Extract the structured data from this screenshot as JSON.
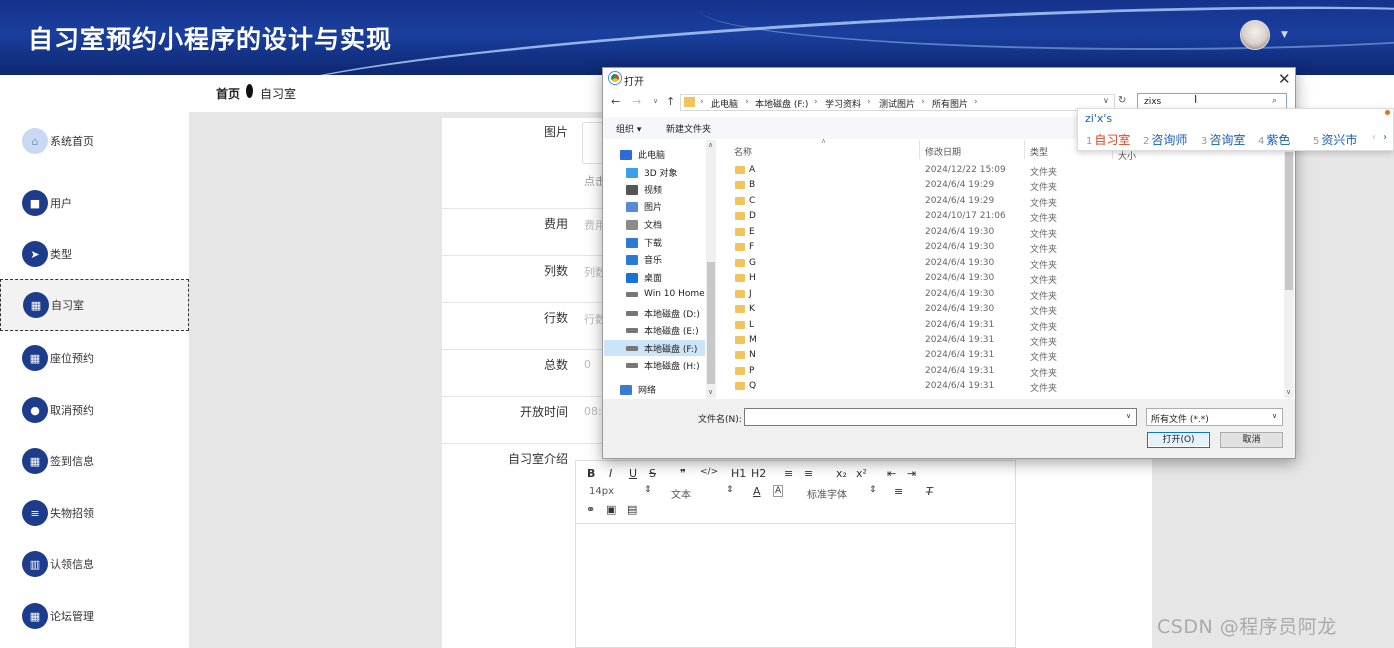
{
  "header": {
    "title": "自习室预约小程序的设计与实现"
  },
  "breadcrumb": {
    "home": "首页",
    "current": "自习室"
  },
  "sidebar": {
    "items": [
      {
        "label": "系统首页",
        "icon": "home-icon",
        "glyph": "⌂"
      },
      {
        "label": "用户",
        "icon": "briefcase-icon",
        "glyph": "■"
      },
      {
        "label": "类型",
        "icon": "paper-plane-icon",
        "glyph": "➤"
      },
      {
        "label": "自习室",
        "icon": "grid-icon",
        "glyph": "▦"
      },
      {
        "label": "座位预约",
        "icon": "grid-icon",
        "glyph": "▦"
      },
      {
        "label": "取消预约",
        "icon": "user-icon",
        "glyph": "●"
      },
      {
        "label": "签到信息",
        "icon": "grid-icon",
        "glyph": "▦"
      },
      {
        "label": "失物招领",
        "icon": "list-icon",
        "glyph": "≡"
      },
      {
        "label": "认领信息",
        "icon": "chart-icon",
        "glyph": "▥"
      },
      {
        "label": "论坛管理",
        "icon": "grid-icon",
        "glyph": "▦"
      }
    ]
  },
  "form": {
    "image_label": "图片",
    "image_hint": "点击",
    "fee_label": "费用",
    "fee_placeholder": "费用",
    "cols_label": "列数",
    "cols_placeholder": "列数",
    "rows_label": "行数",
    "rows_placeholder": "行数",
    "total_label": "总数",
    "total_value": "0",
    "open_time_label": "开放时间",
    "open_time_value": "08:0",
    "intro_label": "自习室介绍"
  },
  "editor": {
    "font_size": "14px",
    "format": "文本",
    "font_family": "标准字体",
    "buttons": [
      "B",
      "I",
      "U",
      "S",
      "❞",
      "</>",
      "H1",
      "H2",
      "≡",
      "≡",
      "x₂",
      "x²",
      "⇤",
      "⇥"
    ]
  },
  "dialog": {
    "title": "打开",
    "path": [
      "此电脑",
      "本地磁盘 (F:)",
      "学习资料",
      "测试图片",
      "所有图片"
    ],
    "search_value": "zixs",
    "organize": "组织 ▾",
    "new_folder": "新建文件夹",
    "columns": {
      "name": "名称",
      "date": "修改日期",
      "type": "类型",
      "size": "大小"
    },
    "nav": [
      {
        "label": "此电脑",
        "icon": "computer-icon",
        "color": "#2b6cd6"
      },
      {
        "label": "3D 对象",
        "icon": "cube-icon",
        "color": "#3aa0e8"
      },
      {
        "label": "视频",
        "icon": "video-icon",
        "color": "#555555"
      },
      {
        "label": "图片",
        "icon": "picture-icon",
        "color": "#5a8ad6"
      },
      {
        "label": "文档",
        "icon": "document-icon",
        "color": "#8a8a8a"
      },
      {
        "label": "下载",
        "icon": "download-icon",
        "color": "#2b7ad6"
      },
      {
        "label": "音乐",
        "icon": "music-icon",
        "color": "#2b7ad6"
      },
      {
        "label": "桌面",
        "icon": "desktop-icon",
        "color": "#1a73d6"
      },
      {
        "label": "Win 10 Home x",
        "icon": "drive-icon",
        "color": "#777777"
      },
      {
        "label": "本地磁盘 (D:)",
        "icon": "drive-icon",
        "color": "#777777"
      },
      {
        "label": "本地磁盘 (E:)",
        "icon": "drive-icon",
        "color": "#777777"
      },
      {
        "label": "本地磁盘 (F:)",
        "icon": "drive-icon",
        "color": "#777777"
      },
      {
        "label": "本地磁盘 (H:)",
        "icon": "drive-icon",
        "color": "#777777"
      },
      {
        "label": "网络",
        "icon": "network-icon",
        "color": "#3a7ad6"
      }
    ],
    "files": [
      {
        "name": "A",
        "date": "2024/12/22 15:09",
        "type": "文件夹"
      },
      {
        "name": "B",
        "date": "2024/6/4 19:29",
        "type": "文件夹"
      },
      {
        "name": "C",
        "date": "2024/6/4 19:29",
        "type": "文件夹"
      },
      {
        "name": "D",
        "date": "2024/10/17 21:06",
        "type": "文件夹"
      },
      {
        "name": "E",
        "date": "2024/6/4 19:30",
        "type": "文件夹"
      },
      {
        "name": "F",
        "date": "2024/6/4 19:30",
        "type": "文件夹"
      },
      {
        "name": "G",
        "date": "2024/6/4 19:30",
        "type": "文件夹"
      },
      {
        "name": "H",
        "date": "2024/6/4 19:30",
        "type": "文件夹"
      },
      {
        "name": "J",
        "date": "2024/6/4 19:30",
        "type": "文件夹"
      },
      {
        "name": "K",
        "date": "2024/6/4 19:30",
        "type": "文件夹"
      },
      {
        "name": "L",
        "date": "2024/6/4 19:31",
        "type": "文件夹"
      },
      {
        "name": "M",
        "date": "2024/6/4 19:31",
        "type": "文件夹"
      },
      {
        "name": "N",
        "date": "2024/6/4 19:31",
        "type": "文件夹"
      },
      {
        "name": "P",
        "date": "2024/6/4 19:31",
        "type": "文件夹"
      },
      {
        "name": "Q",
        "date": "2024/6/4 19:31",
        "type": "文件夹"
      }
    ],
    "filename_label": "文件名(N):",
    "filename_value": "",
    "filetype": "所有文件 (*.*)",
    "open_button": "打开(O)",
    "cancel_button": "取消"
  },
  "ime": {
    "pinyin": "zi'x's",
    "candidates": [
      {
        "num": "1",
        "text": "自习室"
      },
      {
        "num": "2",
        "text": "咨询师"
      },
      {
        "num": "3",
        "text": "咨询室"
      },
      {
        "num": "4",
        "text": "紫色"
      },
      {
        "num": "5",
        "text": "资兴市"
      }
    ]
  },
  "watermark": "CSDN @程序员阿龙"
}
